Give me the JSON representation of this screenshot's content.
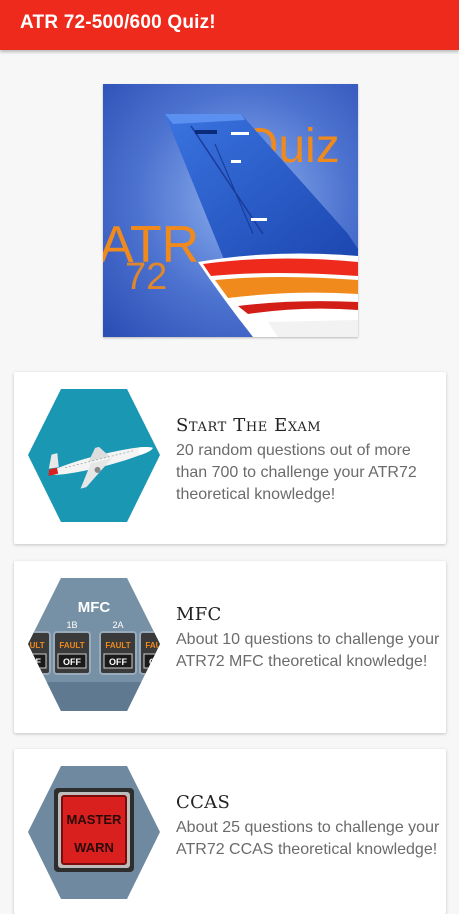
{
  "app_bar": {
    "title": "ATR 72-500/600 Quiz!"
  },
  "hero": {
    "logo_text_1": "Quiz",
    "logo_text_2": "ATR",
    "logo_text_3": "72"
  },
  "cards": [
    {
      "title": "Start The Exam",
      "description": "20 random questions out of more than 700 to challenge your ATR72 theoretical knowledge!",
      "icon": "airplane-icon"
    },
    {
      "title": "MFC",
      "description": "About 10 questions to challenge your ATR72 MFC theoretical knowledge!",
      "icon": "mfc-panel-icon",
      "panel": {
        "heading": "MFC",
        "columns": [
          "1B",
          "2A"
        ],
        "fault": "FAULT",
        "off": "OFF"
      }
    },
    {
      "title": "CCAS",
      "description": "About 25 questions to challenge your ATR72 CCAS theoretical knowledge!",
      "icon": "master-warn-icon",
      "button": {
        "line1": "MASTER",
        "line2": "WARN"
      }
    }
  ],
  "colors": {
    "app_bar": "#ee2a1c",
    "hero_bg": "#3f63c4",
    "tail_blue": "#2457c8",
    "logo_orange": "#f08a1c",
    "hex_teal": "#1a97b2",
    "hex_gray": "#6f8aa0",
    "warn_red": "#d9201e"
  }
}
